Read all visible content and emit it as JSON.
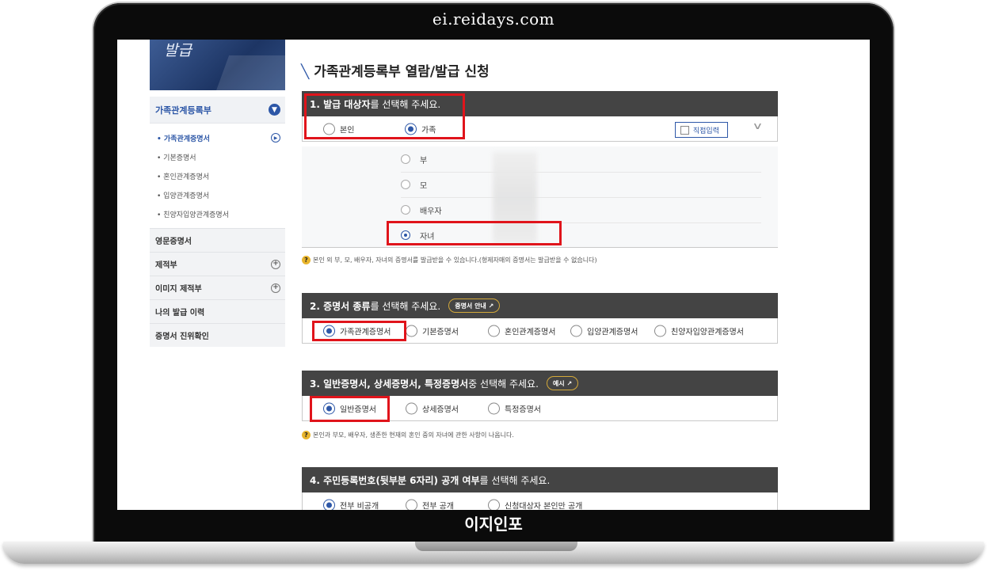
{
  "window": {
    "site_url": "ei.reidays.com",
    "caption": "이지인포"
  },
  "banner": {
    "title": "발급"
  },
  "sidebar": {
    "group_title": "가족관계등록부",
    "sub_items": [
      {
        "label": "• 가족관계증명서",
        "active": true
      },
      {
        "label": "• 기본증명서"
      },
      {
        "label": "• 혼인관계증명서"
      },
      {
        "label": "• 입양관계증명서"
      },
      {
        "label": "• 친양자입양관계증명서"
      }
    ],
    "menus": [
      {
        "label": "영문증명서"
      },
      {
        "label": "제적부"
      },
      {
        "label": "이미지 제적부"
      },
      {
        "label": "나의 발급 이력"
      },
      {
        "label": "증명서 진위확인"
      }
    ]
  },
  "page": {
    "title": "가족관계등록부 열람/발급 신청"
  },
  "section1": {
    "title_bold": "1. 발급 대상자",
    "title_rest": "를 선택해 주세요.",
    "options": [
      "본인",
      "가족"
    ],
    "selected": "가족",
    "direct_input": "직접입력",
    "family": [
      "부",
      "모",
      "배우자",
      "자녀"
    ],
    "family_selected": "자녀",
    "note": "본인 외 부, 모, 배우자, 자녀의 증명서를 발급받을 수 있습니다.(형제자매의 증명서는 발급받을 수 없습니다)"
  },
  "section2": {
    "title_bold": "2. 증명서 종류",
    "title_rest": "를 선택해 주세요.",
    "guide": "증명서 안내",
    "options": [
      "가족관계증명서",
      "기본증명서",
      "혼인관계증명서",
      "입양관계증명서",
      "친양자입양관계증명서"
    ],
    "selected": "가족관계증명서"
  },
  "section3": {
    "title_bold": "3. 일반증명서, 상세증명서, 특정증명서",
    "title_rest": " 중 선택해 주세요.",
    "example": "예시",
    "options": [
      "일반증명서",
      "상세증명서",
      "특정증명서"
    ],
    "selected": "일반증명서",
    "note": "본인과 부모, 배우자, 생존한 현재의 혼인 중의 자녀에 관한 사항이 나옵니다."
  },
  "section4": {
    "title_bold": "4. 주민등록번호(뒷부분 6자리) 공개 여부",
    "title_rest": "를 선택해 주세요.",
    "options": [
      "전부 비공개",
      "전부 공개",
      "신청대상자 본인만 공개"
    ],
    "selected": "전부 비공개"
  },
  "colors": {
    "accent": "#2d57a7",
    "highlight": "#e0141b",
    "header_bg": "#444444",
    "note_icon": "#e9b52c"
  }
}
